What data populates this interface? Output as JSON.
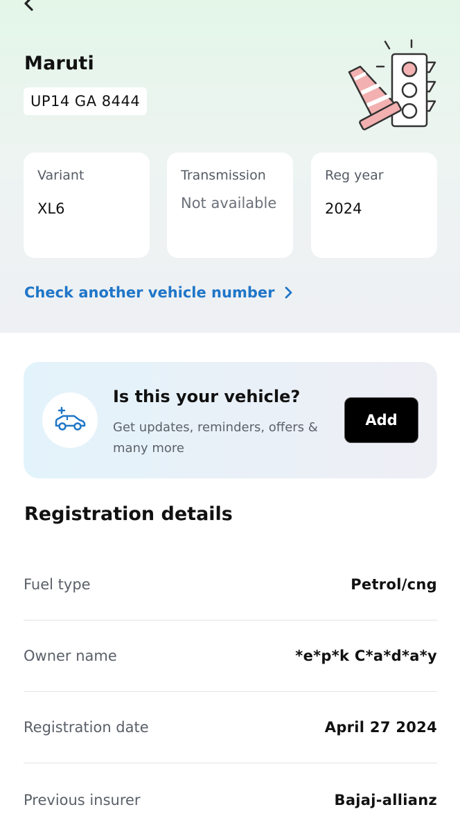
{
  "vehicle": {
    "brand": "Maruti",
    "plate": "UP14 GA 8444"
  },
  "info_cards": [
    {
      "label": "Variant",
      "value": "XL6"
    },
    {
      "label": "Transmission",
      "value": "Not available"
    },
    {
      "label": "Reg year",
      "value": "2024"
    }
  ],
  "check_link": {
    "label": "Check another vehicle number"
  },
  "banner": {
    "title": "Is this your vehicle?",
    "subtitle": "Get updates, reminders, offers & many more",
    "button": "Add"
  },
  "registration": {
    "title": "Registration details",
    "rows": [
      {
        "label": "Fuel type",
        "value": "Petrol/cng"
      },
      {
        "label": "Owner name",
        "value": "*e*p*k C*a*d*a*y"
      },
      {
        "label": "Registration date",
        "value": "April 27 2024"
      },
      {
        "label": "Previous insurer",
        "value": "Bajaj-allianz"
      }
    ]
  },
  "icons": {
    "back": "chevron-left-icon",
    "link": "chevron-right-icon",
    "car": "car-icon",
    "illustration": "traffic-light-cone-icon"
  },
  "colors": {
    "link": "#1f76c8",
    "button_bg": "#000000",
    "top_gradient_start": "#e3f6e8",
    "top_gradient_end": "#eef0f4",
    "illustration_pink": "#f0a8a8"
  }
}
